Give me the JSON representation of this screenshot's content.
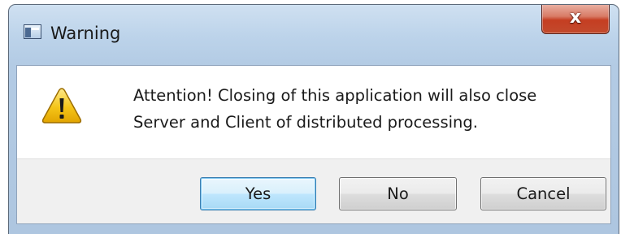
{
  "window": {
    "title": "Warning",
    "app_icon": "application-window-icon",
    "close_label": "x"
  },
  "dialog": {
    "icon": "warning-triangle-icon",
    "message_lines": [
      "Attention! Closing of this application will also close",
      "Server and Client of distributed processing."
    ]
  },
  "buttons": {
    "yes": "Yes",
    "no": "No",
    "cancel": "Cancel",
    "default": "yes"
  },
  "colors": {
    "title_gradient_top": "#cfe0f1",
    "close_button": "#c53e22",
    "warning_yellow": "#f5c518",
    "default_button_border": "#3c7fb1"
  }
}
